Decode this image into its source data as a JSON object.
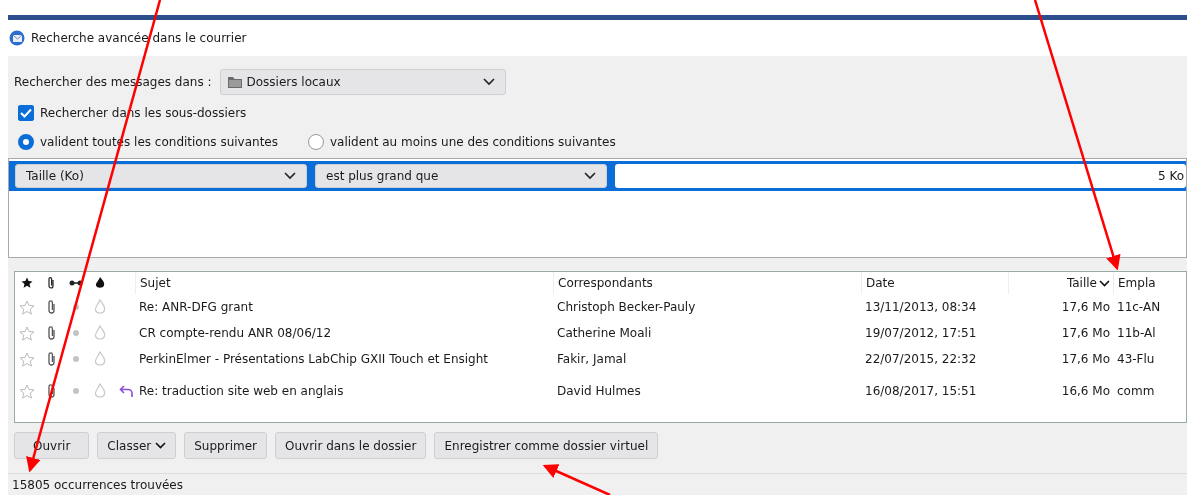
{
  "window": {
    "title": "Recherche avancée dans le courrier"
  },
  "search_in": {
    "label": "Rechercher des messages dans :",
    "value": "Dossiers locaux"
  },
  "subfolders": {
    "label": "Rechercher dans les sous-dossiers",
    "checked": true
  },
  "match_options": [
    {
      "label": "valident toutes les conditions suivantes",
      "selected": true
    },
    {
      "label": "valident au moins une des conditions suivantes",
      "selected": false
    }
  ],
  "condition": {
    "field": "Taille (Ko)",
    "operator": "est plus grand que",
    "value": "5 Ko"
  },
  "table": {
    "columns": [
      {
        "label": "Sujet",
        "sorted": false
      },
      {
        "label": "Correspondants",
        "sorted": false
      },
      {
        "label": "Date",
        "sorted": false
      },
      {
        "label": "Taille",
        "sorted": true
      },
      {
        "label": "Empla",
        "sorted": false
      }
    ],
    "rows": [
      {
        "subject": "Re: ANR-DFG grant",
        "correspondent": "Christoph Becker-Pauly",
        "date": "13/11/2013, 08:34",
        "size": "17,6 Mo",
        "location": "11c-AN",
        "replied": false
      },
      {
        "subject": "CR compte-rendu ANR 08/06/12",
        "correspondent": "Catherine Moali",
        "date": "19/07/2012, 17:51",
        "size": "17,6 Mo",
        "location": "11b-Al",
        "replied": false
      },
      {
        "subject": "PerkinElmer - Présentations LabChip GXII Touch et Ensight",
        "correspondent": "Fakir, Jamal",
        "date": "22/07/2015, 22:32",
        "size": "17,6 Mo",
        "location": "43-Flu",
        "replied": false
      },
      {
        "subject": "Re: traduction site web en anglais",
        "correspondent": "David Hulmes",
        "date": "16/08/2017, 15:51",
        "size": "16,6 Mo",
        "location": "comm",
        "replied": true
      }
    ]
  },
  "buttons": [
    {
      "label": "Ouvrir",
      "kind": "plain"
    },
    {
      "label": "Classer",
      "kind": "menu"
    },
    {
      "label": "Supprimer",
      "kind": "plain"
    },
    {
      "label": "Ouvrir dans le dossier",
      "kind": "plain"
    },
    {
      "label": "Enregistrer comme dossier virtuel",
      "kind": "plain"
    }
  ],
  "status_bar": "15805 occurrences trouvées"
}
